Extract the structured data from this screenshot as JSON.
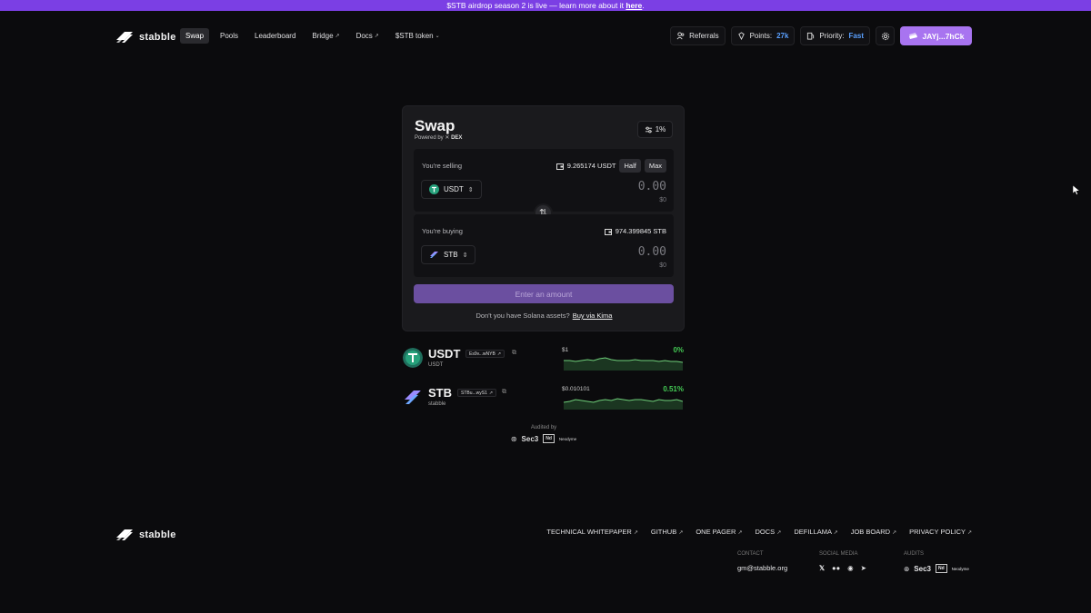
{
  "banner": {
    "text": "$STB airdrop season 2 is live — learn more about it ",
    "link": "here",
    "end": "."
  },
  "brand": {
    "name": "stabble"
  },
  "nav": {
    "links": [
      {
        "label": "Swap",
        "active": true,
        "external": false
      },
      {
        "label": "Pools",
        "external": false
      },
      {
        "label": "Leaderboard",
        "external": false
      },
      {
        "label": "Bridge",
        "external": true
      },
      {
        "label": "Docs",
        "external": true
      },
      {
        "label": "$STB token",
        "dropdown": true
      }
    ],
    "referrals": "Referrals",
    "points_label": "Points:",
    "points_value": "27k",
    "priority_label": "Priority:",
    "priority_value": "Fast",
    "wallet": "JAYj...7hCk"
  },
  "swap": {
    "title": "Swap",
    "powered_by": "Powered by",
    "powered_name": "DEX",
    "slippage": "1%",
    "sell": {
      "label": "You're selling",
      "balance": "9.265174 USDT",
      "half": "Half",
      "max": "Max",
      "token": "USDT",
      "amount": "0.00",
      "usd": "$0"
    },
    "buy": {
      "label": "You're buying",
      "balance": "974.399845 STB",
      "token": "STB",
      "amount": "0.00",
      "usd": "$0"
    },
    "cta": "Enter an amount",
    "kima_text": "Don't you have Solana assets?",
    "kima_link": "Buy via Kima"
  },
  "tokens": [
    {
      "symbol": "USDT",
      "sub": "USDT",
      "addr": "Es9v...wNYB",
      "price": "$1",
      "change": "0%",
      "spark": [
        5,
        5,
        6,
        5,
        4,
        5,
        3,
        2,
        4,
        5,
        5,
        5,
        4,
        5,
        5,
        5,
        6,
        5,
        6,
        6,
        7
      ]
    },
    {
      "symbol": "STB",
      "sub": "stabble",
      "addr": "STBu...wyS1",
      "price": "$0.010101",
      "change": "0.51%",
      "spark": [
        8,
        7,
        5,
        6,
        7,
        8,
        6,
        5,
        6,
        4,
        5,
        6,
        5,
        5,
        6,
        7,
        5,
        6,
        6,
        5,
        7
      ]
    }
  ],
  "audit": {
    "label": "Audited by",
    "a1": "Sec3",
    "a2_box": "Nd",
    "a2": "Neodyme"
  },
  "footer": {
    "links": [
      "TECHNICAL WHITEPAPER",
      "GITHUB",
      "ONE PAGER",
      "DOCS",
      "DEFILLAMA",
      "JOB BOARD",
      "PRIVACY POLICY"
    ],
    "contact_label": "CONTACT",
    "contact_value": "gm@stabble.org",
    "social_label": "SOCIAL MEDIA",
    "audits_label": "AUDITS"
  },
  "colors": {
    "accent": "#7b3fe4",
    "wallet": "#a874f0",
    "positive": "#44cc55",
    "highlight": "#5aa0ff"
  }
}
